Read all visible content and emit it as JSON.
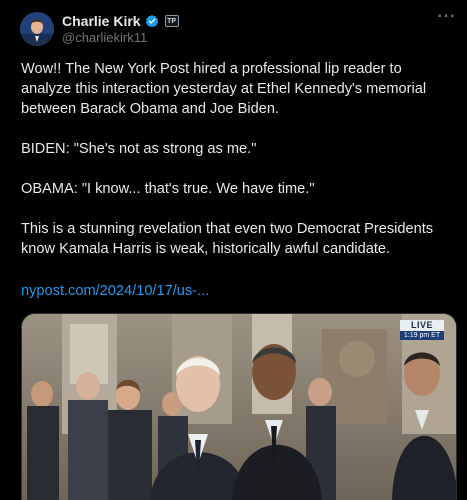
{
  "author": {
    "display_name": "Charlie Kirk",
    "handle": "@charliekirk11",
    "verified": true,
    "affiliation_badge": "TP",
    "avatar": "avatar-photo"
  },
  "menu": {
    "more_label": "···"
  },
  "tweet": {
    "paragraphs": [
      "Wow!! The New York Post hired a professional lip reader to analyze this interaction yesterday at Ethel Kennedy's memorial between Barack Obama and Joe Biden.",
      "BIDEN: \"She's not as strong as me.\"",
      "OBAMA: \"I know... that's true. We have time.\"",
      "This is a stunning revelation that even two Democrat Presidents know Kamala Harris is weak, historically awful candidate."
    ],
    "link_text": "nypost.com/2024/10/17/us-..."
  },
  "media": {
    "live_label": "LIVE",
    "live_time": "1:19 pm ET"
  },
  "colors": {
    "background": "#000000",
    "text": "#e7e9ea",
    "secondary": "#71767b",
    "link": "#1d9bf0",
    "verified": "#1d9bf0"
  }
}
